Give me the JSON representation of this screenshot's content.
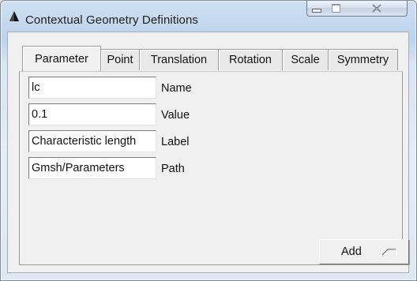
{
  "window": {
    "title": "Contextual Geometry Definitions",
    "icon": "gmsh-triangle-icon",
    "controls": [
      "minimize-icon",
      "maximize-icon",
      "close-icon"
    ]
  },
  "tabs": [
    {
      "label": "Parameter",
      "active": true
    },
    {
      "label": "Point",
      "active": false
    },
    {
      "label": "Translation",
      "active": false
    },
    {
      "label": "Rotation",
      "active": false
    },
    {
      "label": "Scale",
      "active": false
    },
    {
      "label": "Symmetry",
      "active": false
    }
  ],
  "fields": [
    {
      "value": "lc",
      "label": "Name"
    },
    {
      "value": "0.1",
      "label": "Value"
    },
    {
      "value": "Characteristic length",
      "label": "Label"
    },
    {
      "value": "Gmsh/Parameters",
      "label": "Path"
    }
  ],
  "buttons": {
    "add_label": "Add"
  },
  "colors": {
    "window_chrome": "#c7d8ec",
    "panel_bg": "#f0f0f0",
    "field_bg": "#ffffff"
  }
}
